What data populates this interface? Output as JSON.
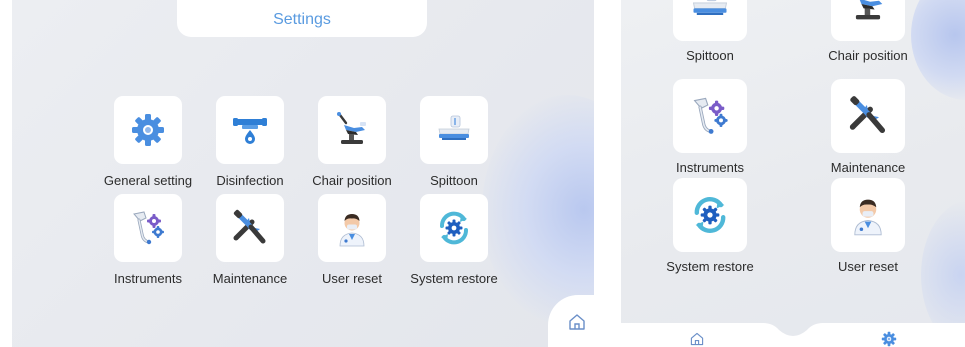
{
  "left": {
    "title": "Settings",
    "row1": [
      {
        "label": "General setting",
        "icon": "gear-icon"
      },
      {
        "label": "Disinfection",
        "icon": "disinfection-icon"
      },
      {
        "label": "Chair position",
        "icon": "chair-icon"
      },
      {
        "label": "Spittoon",
        "icon": "spittoon-icon"
      }
    ],
    "row2": [
      {
        "label": "Instruments",
        "icon": "instruments-icon"
      },
      {
        "label": "Maintenance",
        "icon": "tools-icon"
      },
      {
        "label": "User reset",
        "icon": "user-icon"
      },
      {
        "label": "System restore",
        "icon": "restore-icon"
      }
    ],
    "home_icon": "home-icon"
  },
  "right": {
    "items": [
      {
        "label": "Spittoon",
        "icon": "spittoon-icon"
      },
      {
        "label": "Chair position",
        "icon": "chair-icon"
      },
      {
        "label": "Instruments",
        "icon": "instruments-icon"
      },
      {
        "label": "Maintenance",
        "icon": "tools-icon"
      },
      {
        "label": "System restore",
        "icon": "restore-icon"
      },
      {
        "label": "User reset",
        "icon": "user-icon"
      }
    ],
    "nav": {
      "home_icon": "home-icon",
      "settings_icon": "gear-icon"
    }
  },
  "colors": {
    "accent": "#5a9be0",
    "icon_blue": "#3f86d8",
    "icon_purple": "#7a5cc8",
    "text": "#2c2c2c"
  }
}
